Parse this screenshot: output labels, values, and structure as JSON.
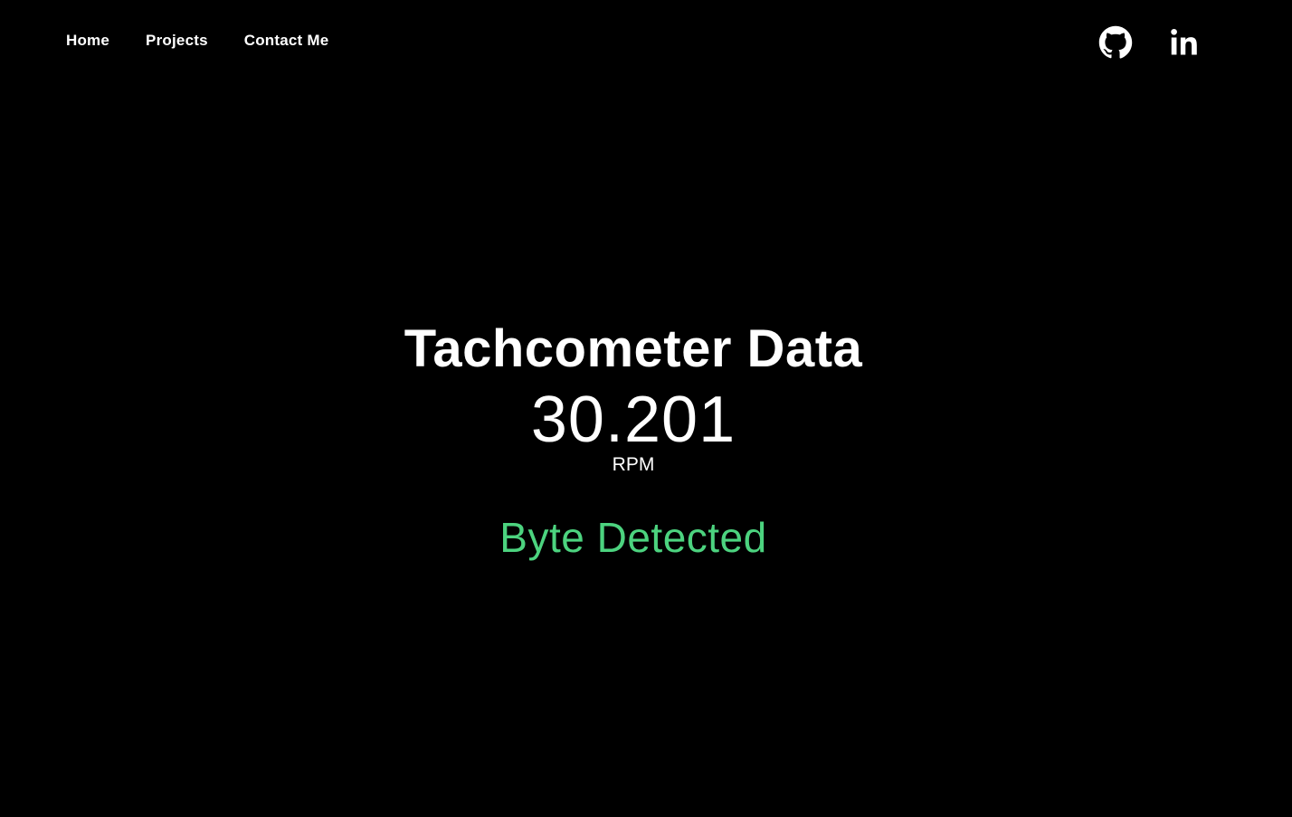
{
  "nav": {
    "links": [
      {
        "label": "Home"
      },
      {
        "label": "Projects"
      },
      {
        "label": "Contact Me"
      }
    ],
    "socials": [
      {
        "icon": "github-icon"
      },
      {
        "icon": "linkedin-icon"
      }
    ]
  },
  "main": {
    "title": "Tachcometer Data",
    "rpm_value": "30.201",
    "rpm_unit": "RPM",
    "status": "Byte Detected"
  },
  "colors": {
    "background": "#000000",
    "text": "#ffffff",
    "status": "#4cd37f"
  }
}
